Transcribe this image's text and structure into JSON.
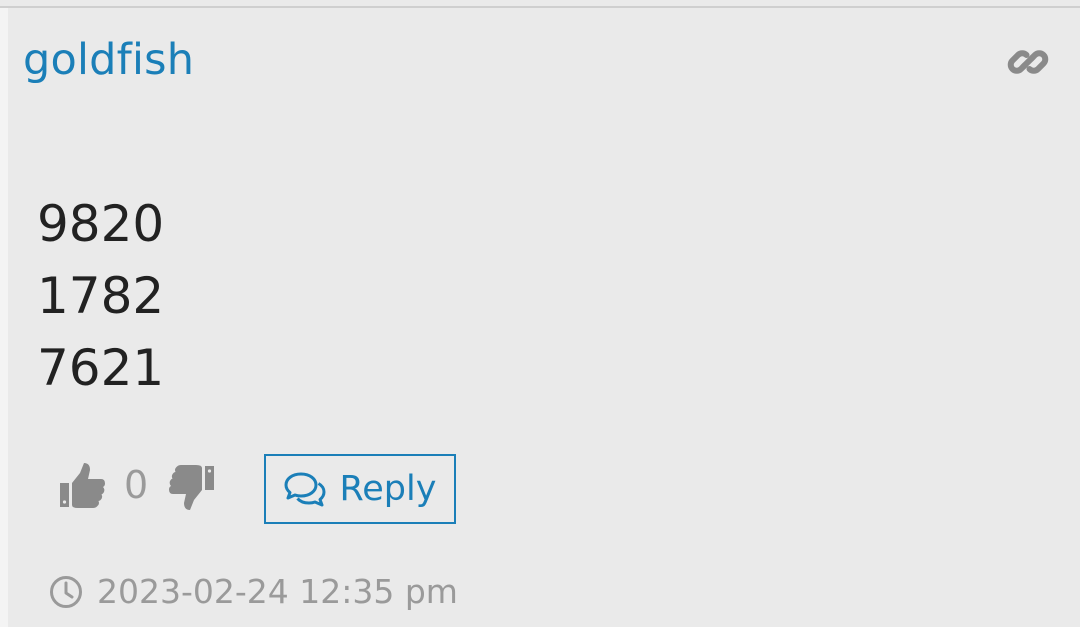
{
  "post": {
    "author": "goldfish",
    "content_lines": [
      "9820",
      "1782",
      "7621"
    ],
    "votes": {
      "count": "0"
    },
    "reply_label": "Reply",
    "timestamp": "2023-02-24 12:35 pm"
  },
  "colors": {
    "accent": "#1b7fb8",
    "muted": "#9a9a9a",
    "text": "#222222",
    "background": "#eaeaea"
  },
  "icons": {
    "permalink": "link-icon",
    "upvote": "thumbs-up-icon",
    "downvote": "thumbs-down-icon",
    "reply": "comments-icon",
    "time": "clock-icon"
  }
}
